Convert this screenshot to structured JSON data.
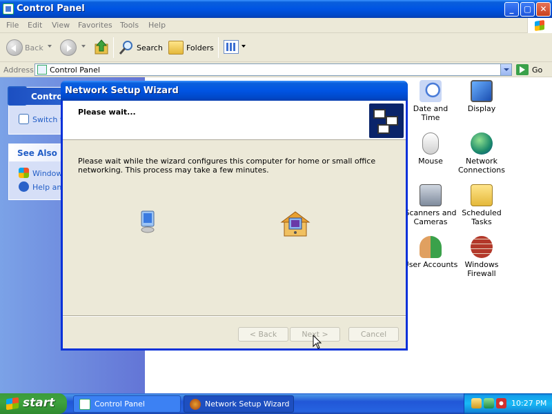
{
  "control_panel": {
    "title": "Control Panel",
    "menu": [
      "File",
      "Edit",
      "View",
      "Favorites",
      "Tools",
      "Help"
    ],
    "toolbar": {
      "back": "Back",
      "search": "Search",
      "folders": "Folders"
    },
    "address_label": "Address",
    "address_value": "Control Panel",
    "go_label": "Go",
    "sidebar": {
      "panel_title": "Control",
      "switch_link": "Switch t",
      "see_also": "See Also",
      "links": [
        "Windows",
        "Help and"
      ]
    },
    "items": [
      {
        "label": "Date and Time",
        "icon": "clock-calendar-icon"
      },
      {
        "label": "Display",
        "icon": "display-icon"
      },
      {
        "label": "Mouse",
        "icon": "mouse-icon"
      },
      {
        "label": "Network Connections",
        "icon": "network-globe-icon"
      },
      {
        "label": "Scanners and Cameras",
        "icon": "scanner-camera-icon"
      },
      {
        "label": "Scheduled Tasks",
        "icon": "scheduled-tasks-icon"
      },
      {
        "label": "User Accounts",
        "icon": "users-icon"
      },
      {
        "label": "Windows Firewall",
        "icon": "firewall-icon"
      }
    ]
  },
  "wizard": {
    "title": "Network Setup Wizard",
    "heading": "Please wait...",
    "body": "Please wait while the wizard configures this computer for home or small office networking. This process may take a few minutes.",
    "buttons": {
      "back": "< Back",
      "next": "Next >",
      "cancel": "Cancel"
    }
  },
  "taskbar": {
    "start": "start",
    "tasks": [
      "Control Panel",
      "Network Setup Wizard"
    ],
    "clock": "10:27 PM"
  }
}
